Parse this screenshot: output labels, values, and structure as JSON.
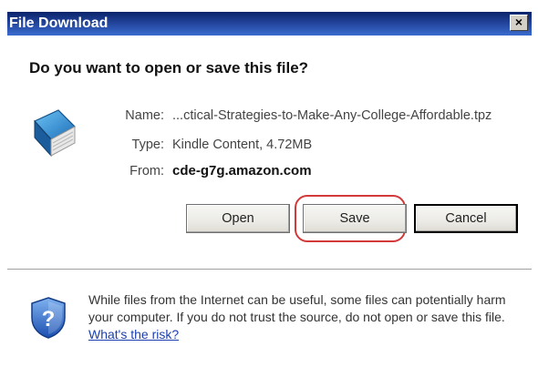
{
  "window": {
    "title": "File Download",
    "close_label": "×"
  },
  "dialog": {
    "question": "Do you want to open or save this file?",
    "file": {
      "name_label": "Name:",
      "name_value": "...ctical-Strategies-to-Make-Any-College-Affordable.tpz",
      "type_label": "Type:",
      "type_value": "Kindle Content, 4.72MB",
      "from_label": "From:",
      "from_value": "cde-g7g.amazon.com"
    },
    "buttons": {
      "open": "Open",
      "save": "Save",
      "cancel": "Cancel"
    },
    "warning": {
      "text": "While files from the Internet can be useful, some files can potentially harm your computer. If you do not trust the source, do not open or save this file.",
      "link": "What's the risk?"
    }
  },
  "colors": {
    "titlebar": "#0a246a",
    "highlight": "#d23a3a",
    "link": "#1a3fb0"
  }
}
